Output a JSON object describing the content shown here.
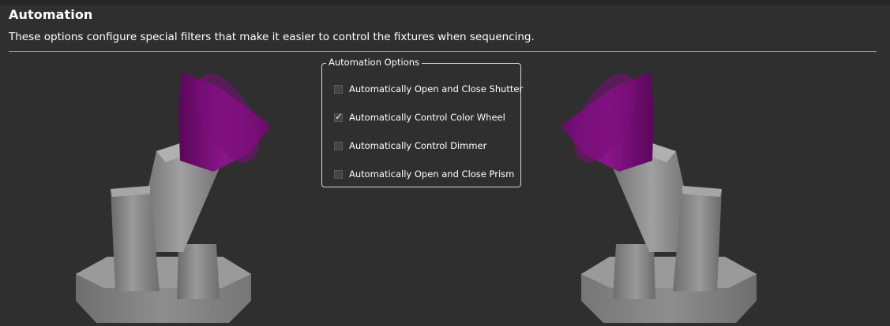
{
  "header": {
    "title": "Automation",
    "description": "These options configure special filters that make it easier to control the fixtures when sequencing."
  },
  "automation_options": {
    "legend": "Automation Options",
    "items": [
      {
        "label": "Automatically Open and Close Shutter",
        "checked": false
      },
      {
        "label": "Automatically Control Color Wheel",
        "checked": true
      },
      {
        "label": "Automatically Control Dimmer",
        "checked": false
      },
      {
        "label": "Automatically Open and Close Prism",
        "checked": false
      }
    ]
  },
  "colors": {
    "background": "#2f2f2f",
    "lens": "#7a0a7a",
    "fixture_body": "#8a8a8a",
    "text": "#ffffff"
  }
}
